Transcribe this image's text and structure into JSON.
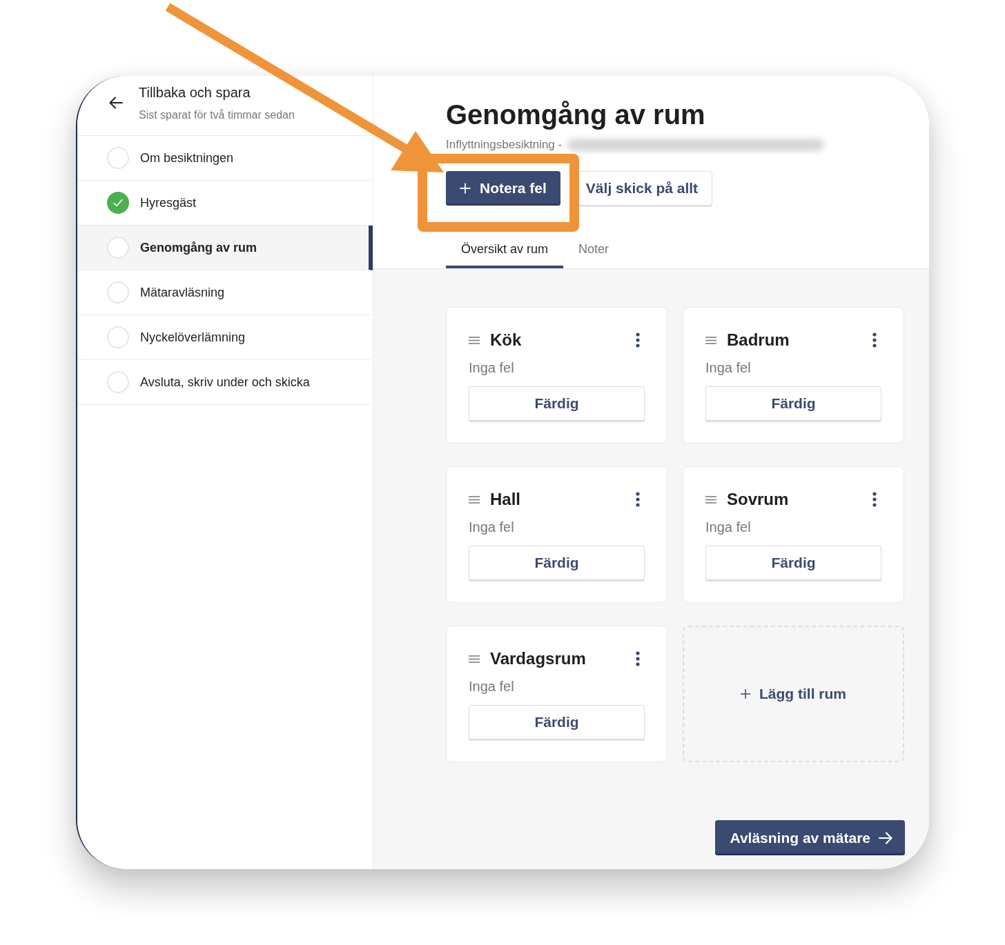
{
  "sidebar": {
    "back": {
      "title": "Tillbaka och spara",
      "subtitle": "Sist sparat för två timmar sedan"
    },
    "steps": [
      {
        "label": "Om besiktningen",
        "done": false,
        "selected": false
      },
      {
        "label": "Hyresgäst",
        "done": true,
        "selected": false
      },
      {
        "label": "Genomgång av rum",
        "done": false,
        "selected": true
      },
      {
        "label": "Mätaravläsning",
        "done": false,
        "selected": false
      },
      {
        "label": "Nyckelöverlämning",
        "done": false,
        "selected": false
      },
      {
        "label": "Avsluta, skriv under och skicka",
        "done": false,
        "selected": false
      }
    ]
  },
  "header": {
    "title": "Genomgång av rum",
    "subtitle": "Inflyttningsbesiktning -",
    "subtitle_redacted": true,
    "actions": [
      {
        "label": "Notera fel",
        "kind": "primary"
      },
      {
        "label": "Välj skick på allt",
        "kind": "secondary"
      }
    ]
  },
  "tabs": [
    {
      "label": "Översikt av rum",
      "selected": true
    },
    {
      "label": "Noter",
      "selected": false
    }
  ],
  "rooms": [
    {
      "name": "Kök",
      "status": "Inga fel",
      "action": "Färdig"
    },
    {
      "name": "Badrum",
      "status": "Inga fel",
      "action": "Färdig"
    },
    {
      "name": "Hall",
      "status": "Inga fel",
      "action": "Färdig"
    },
    {
      "name": "Sovrum",
      "status": "Inga fel",
      "action": "Färdig"
    },
    {
      "name": "Vardagsrum",
      "status": "Inga fel",
      "action": "Färdig"
    }
  ],
  "add_room": {
    "label": "Lägg till rum"
  },
  "next_button": {
    "label": "Avläsning av mätare"
  }
}
